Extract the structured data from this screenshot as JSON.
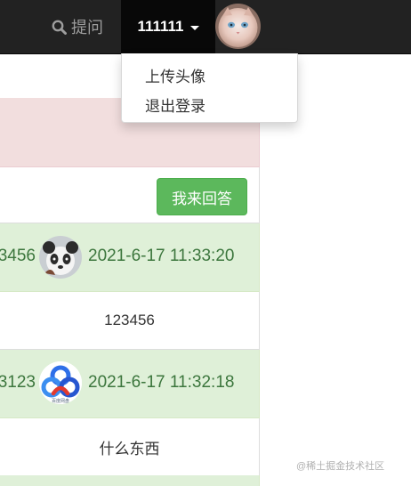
{
  "navbar": {
    "ask_label": "提问",
    "username": "111111"
  },
  "dropdown": {
    "items": [
      "上传头像",
      "退出登录"
    ]
  },
  "question": {
    "answer_button": "我来回答"
  },
  "replies": [
    {
      "user": "3456",
      "time": "2021-6-17 11:33:20",
      "content": "123456",
      "avatar": "panda-avatar"
    },
    {
      "user": "3123",
      "time": "2021-6-17 11:32:18",
      "content": "什么东西",
      "avatar": "baidu-netdisk-avatar",
      "avatar_caption": "百度网盘"
    }
  ],
  "watermark": "@稀土掘金技术社区",
  "colors": {
    "navbar_bg": "#222222",
    "navbar_active_bg": "#080808",
    "danger_bg": "#f2dede",
    "success_bg": "#dff0d8",
    "success_text": "#3c763d",
    "button_green": "#5cb85c"
  }
}
